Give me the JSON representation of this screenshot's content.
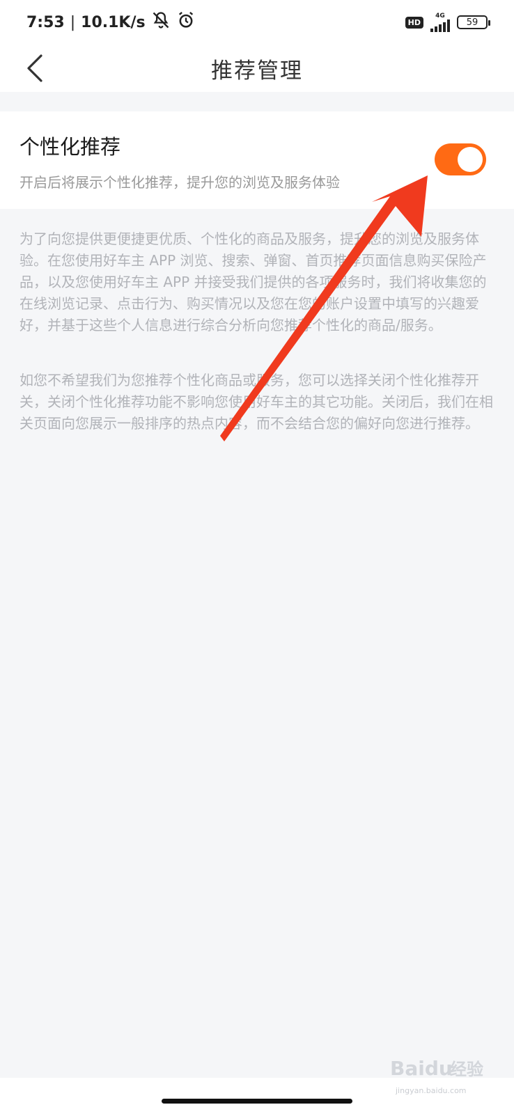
{
  "status_bar": {
    "time": "7:53",
    "separator": "|",
    "net_speed": "10.1K/s",
    "network": "4G",
    "hd": "HD",
    "battery": "59",
    "icons": [
      "mute-icon",
      "alarm-icon",
      "signal-icon",
      "battery-icon"
    ]
  },
  "nav": {
    "title": "推荐管理",
    "back_icon": "chevron-left-icon"
  },
  "setting": {
    "title": "个性化推荐",
    "subtitle": "开启后将展示个性化推荐，提升您的浏览及服务体验",
    "toggle_on": true,
    "toggle_color": "#ff6a14"
  },
  "info": {
    "paragraph_1": "为了向您提供更便捷更优质、个性化的商品及服务，提升您的浏览及服务体验。在您使用好车主 APP 浏览、搜索、弹窗、首页推荐页面信息购买保险产品，以及您使用好车主 APP 并接受我们提供的各项服务时，我们将收集您的在线浏览记录、点击行为、购买情况以及您在您的账户设置中填写的兴趣爱好，并基于这些个人信息进行综合分析向您推荐个性化的商品/服务。",
    "paragraph_2": "如您不希望我们为您推荐个性化商品或服务，您可以选择关闭个性化推荐开关，关闭个性化推荐功能不影响您使用好车主的其它功能。关闭后，我们在相关页面向您展示一般排序的热点内容，而不会结合您的偏好向您进行推荐。"
  },
  "annotation": {
    "arrow_color": "#f03a1e"
  },
  "watermark": {
    "brand": "Baidu",
    "label": "经验",
    "url": "jingyan.baidu.com"
  }
}
